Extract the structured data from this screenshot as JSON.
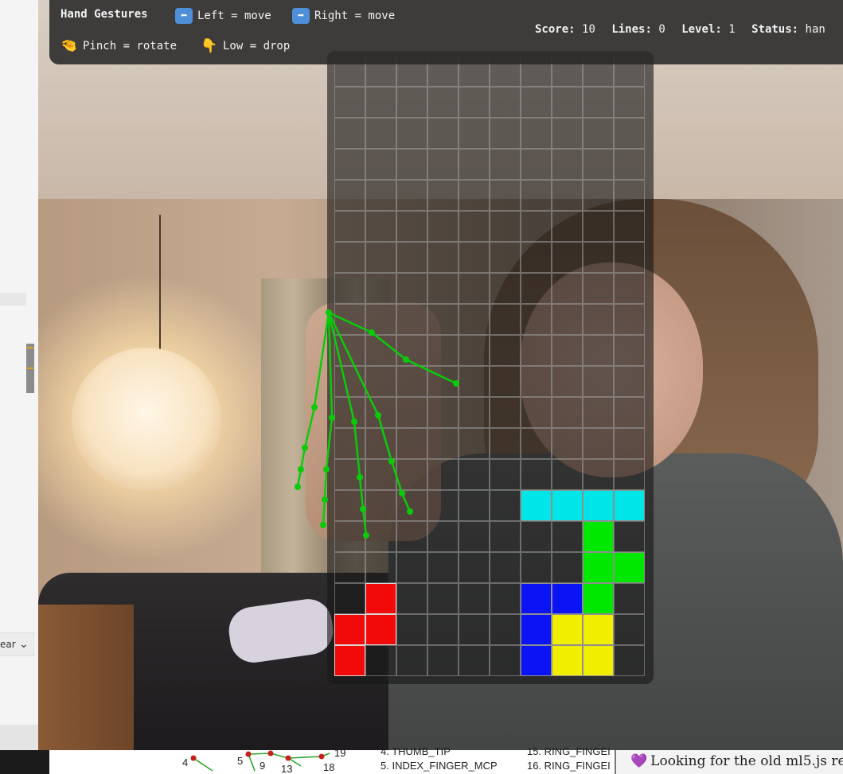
{
  "side_panel": {
    "select_text": "ear",
    "select_chevron": "chevron-down-icon"
  },
  "hud": {
    "title": "Hand Gestures",
    "gestures": [
      {
        "icon": "left-arrow-icon",
        "glyph": "⬅",
        "text": "Left = move"
      },
      {
        "icon": "right-arrow-icon",
        "glyph": "➡",
        "text": "Right = move"
      },
      {
        "icon": "pinch-hand-icon",
        "glyph": "🤏",
        "text": "Pinch = rotate"
      },
      {
        "icon": "point-down-icon",
        "glyph": "👇",
        "text": "Low = drop"
      }
    ],
    "stats": {
      "score_label": "Score:",
      "score": "10",
      "lines_label": "Lines:",
      "lines": "0",
      "level_label": "Level:",
      "level": "1",
      "status_label": "Status:",
      "status": "han"
    }
  },
  "tetris": {
    "cols": 10,
    "rows": 20,
    "colors": {
      "c": "#00e5e8",
      "g": "#00e800",
      "b": "#0a14f5",
      "y": "#f2ee00",
      "r": "#f20a0a"
    },
    "board": [
      "..........",
      "..........",
      "..........",
      "..........",
      "..........",
      "..........",
      "..........",
      "..........",
      "..........",
      "..........",
      "..........",
      "..........",
      "..........",
      "..........",
      "......cccc",
      "........g.",
      "........gg",
      ".r....bbg.",
      "rr....byy.",
      "r.....byy."
    ]
  },
  "bottom": {
    "diagram_numbers": [
      "4",
      "5",
      "9",
      "13",
      "18",
      "19"
    ],
    "list_left": [
      "4. THUMB_TIP",
      "5. INDEX_FINGER_MCP"
    ],
    "list_right": [
      "15. RING_FINGEI",
      "16. RING_FINGEI"
    ],
    "notice": "Looking for the old ml5.js re"
  }
}
